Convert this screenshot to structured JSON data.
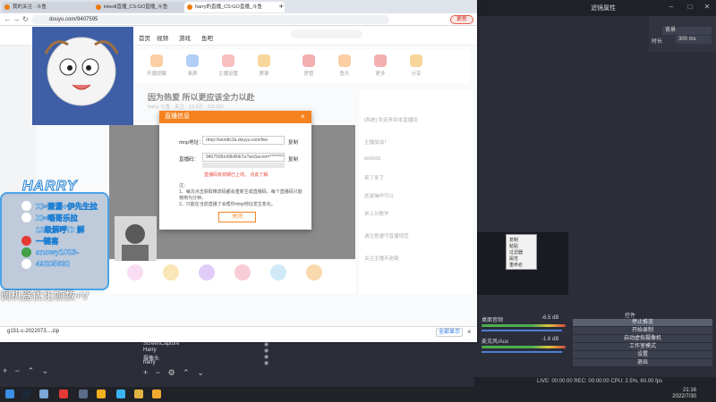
{
  "browser": {
    "tabs": [
      {
        "label": "我的关注 - 斗鱼"
      },
      {
        "label": "inkedl直播_CS:GO直播_斗鱼"
      },
      {
        "label": "harry的直播_CS:GO直播_斗鱼"
      }
    ],
    "url": "douyu.com/9407595",
    "update_label": "更新"
  },
  "site": {
    "nav": [
      "首页",
      "视频",
      "游戏",
      "鱼吧"
    ],
    "categories": [
      "开播提醒",
      "录屏",
      "主播设置",
      "赛事",
      "房管",
      "鱼丸",
      "更多",
      "分享"
    ],
    "stream_title": "因为热爱 所以更应该全力以赴",
    "stream_meta": "harry 斗鱼 · 关注 · 12.5万 · CS:GO",
    "chat_lines": [
      "[系统] 欢迎来到本直播间",
      "主播加油！",
      "666666",
      "来了来了",
      "这波操作可以",
      "求上分教学",
      "请注意遵守直播规范",
      "关注主播不迷路"
    ]
  },
  "dialog": {
    "title": "直播信息",
    "rtmp_label": "rtmp地址：",
    "rtmp_value": "rtmp://sendtc3a.douyu.com/live",
    "key_label": "直播码：",
    "key_value": "9407595rnI9kRhkTu?wsSecret=**********",
    "copy_label": "复制",
    "link_text": "直播码有效期已上线，   点此了解",
    "note_title": "注：",
    "notes": [
      "1、每次点击获取推流码都会重新生成直播码，每个直播码只能使用为分钟。",
      "2、只能在当前直播了会帮你rtmp地址发生变化。"
    ],
    "close_label": "关闭"
  },
  "downloads": {
    "file": "g151-c-2022073....zip",
    "show_all": "全部显示"
  },
  "overlay": {
    "logo": "HARRY",
    "lines": [
      "XI=萧潇+伊先生拉",
      "XI=唱哥乐拉",
      "12级解呼ID   解",
      "一键喜",
      "snowy1023-",
      "49205632"
    ],
    "promo": "调机器优化帧数+V"
  },
  "obs": {
    "properties_title": "滤镜属性",
    "prop_field": "背景",
    "prop_label": "时长",
    "prop_value": "300 ms",
    "context_menu": [
      "复制",
      "粘贴",
      "过滤器",
      "属性",
      "重命名"
    ],
    "mixer": [
      {
        "name": "桌面音频",
        "db": "-6.5 dB"
      },
      {
        "name": "麦克风/Aux",
        "db": "-1.6 dB"
      }
    ],
    "controls_title": "控件",
    "controls": [
      "停止推流",
      "开始录制",
      "启动虚拟摄像机",
      "工作室模式",
      "设置",
      "退出"
    ],
    "sources": [
      "ScreenCapture",
      "Harry",
      "摄像头",
      "harry"
    ],
    "status": "LIVE: 00:00:00   REC: 00:00:00   CPU: 2.5%, 60.00 fps",
    "time": "21:16",
    "date": "2022/7/30"
  }
}
